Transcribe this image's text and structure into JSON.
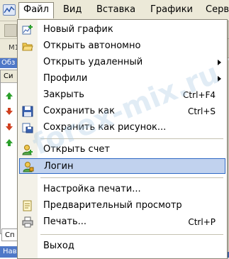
{
  "menubar": {
    "items": [
      {
        "label": "Файл"
      },
      {
        "label": "Вид"
      },
      {
        "label": "Вставка"
      },
      {
        "label": "Графики"
      },
      {
        "label": "Серв"
      }
    ]
  },
  "background": {
    "tab_label": "M1",
    "panel_head": "Обз",
    "list_head": "Си",
    "bottom_tab": "Сп",
    "status_text": "Нав"
  },
  "file_menu": {
    "items": [
      {
        "label": "Новый график",
        "shortcut": "",
        "icon": "new-chart-icon",
        "submenu": false
      },
      {
        "label": "Открыть автономно",
        "shortcut": "",
        "icon": "open-folder-icon",
        "submenu": false
      },
      {
        "label": "Открыть удаленный",
        "shortcut": "",
        "icon": "",
        "submenu": true
      },
      {
        "label": "Профили",
        "shortcut": "",
        "icon": "",
        "submenu": true
      },
      {
        "label": "Закрыть",
        "shortcut": "Ctrl+F4",
        "icon": "",
        "submenu": false
      },
      {
        "label": "Сохранить как",
        "shortcut": "Ctrl+S",
        "icon": "floppy-disk-icon",
        "submenu": false
      },
      {
        "label": "Сохранить как рисунок...",
        "shortcut": "",
        "icon": "save-picture-icon",
        "submenu": false
      },
      {
        "label": "Открыть счет",
        "shortcut": "",
        "icon": "open-account-icon",
        "submenu": false
      },
      {
        "label": "Логин",
        "shortcut": "",
        "icon": "login-icon",
        "submenu": false,
        "highlighted": true
      },
      {
        "label": "Настройка печати...",
        "shortcut": "",
        "icon": "",
        "submenu": false
      },
      {
        "label": "Предварительный просмотр",
        "shortcut": "",
        "icon": "print-preview-icon",
        "submenu": false
      },
      {
        "label": "Печать...",
        "shortcut": "Ctrl+P",
        "icon": "printer-icon",
        "submenu": false
      },
      {
        "label": "Выход",
        "shortcut": "",
        "icon": "",
        "submenu": false
      }
    ]
  },
  "watermark": "forex-mix.ru",
  "colors": {
    "highlight_bg": "#c1d2ee",
    "highlight_border": "#316ac5",
    "menubar_bg": "#ece9d8",
    "status_blue": "#4f78c8"
  }
}
